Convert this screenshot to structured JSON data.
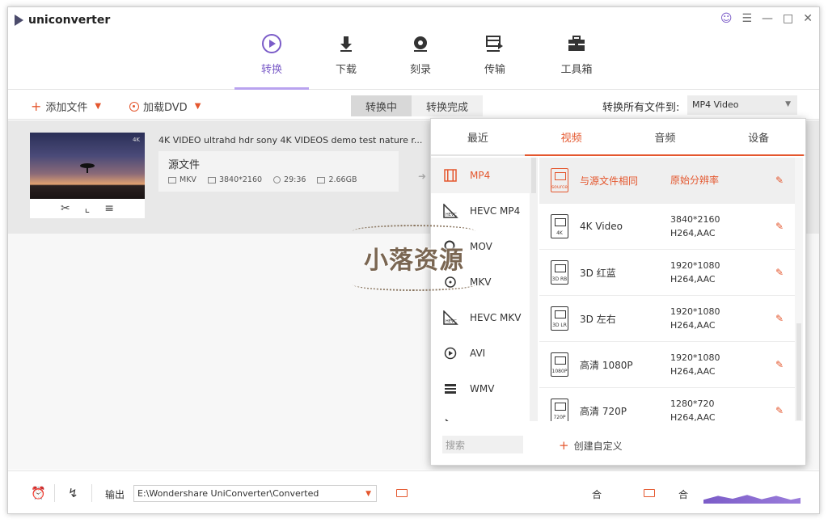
{
  "app": {
    "name": "uniconverter"
  },
  "nav": [
    {
      "key": "convert",
      "label": "转换",
      "active": true
    },
    {
      "key": "download",
      "label": "下载",
      "active": false
    },
    {
      "key": "burn",
      "label": "刻录",
      "active": false
    },
    {
      "key": "transfer",
      "label": "传输",
      "active": false
    },
    {
      "key": "tools",
      "label": "工具箱",
      "active": false
    }
  ],
  "toolbar": {
    "add_files": "添加文件",
    "load_dvd": "加载DVD",
    "seg_converting": "转换中",
    "seg_done": "转换完成",
    "convert_all_label": "转换所有文件到:",
    "target_format": "MP4 Video"
  },
  "file": {
    "title": "4K VIDEO ultrahd hdr sony 4K VIDEOS demo test nature r...",
    "thumb_badge": "4K",
    "source_label": "源文件",
    "format": "MKV",
    "resolution": "3840*2160",
    "duration": "29:36",
    "size": "2.66GB"
  },
  "panel": {
    "tabs": [
      "最近",
      "视频",
      "音频",
      "设备"
    ],
    "active_tab": 1,
    "formats": [
      {
        "label": "MP4",
        "icon": "film-icon",
        "active": true
      },
      {
        "label": "HEVC MP4",
        "icon": "hevc-icon",
        "active": false
      },
      {
        "label": "MOV",
        "icon": "quicktime-icon",
        "active": false
      },
      {
        "label": "MKV",
        "icon": "mkv-icon",
        "active": false
      },
      {
        "label": "HEVC MKV",
        "icon": "hevc-icon",
        "active": false
      },
      {
        "label": "AVI",
        "icon": "play-circle-icon",
        "active": false
      },
      {
        "label": "WMV",
        "icon": "wmv-icon",
        "active": false
      }
    ],
    "presets": [
      {
        "name": "与源文件相同",
        "res": "原始分辨率",
        "codec": "",
        "badge": "source",
        "active": true
      },
      {
        "name": "4K Video",
        "res": "3840*2160",
        "codec": "H264,AAC",
        "badge": "4K",
        "active": false
      },
      {
        "name": "3D 红蓝",
        "res": "1920*1080",
        "codec": "H264,AAC",
        "badge": "3D RB",
        "active": false
      },
      {
        "name": "3D 左右",
        "res": "1920*1080",
        "codec": "H264,AAC",
        "badge": "3D LR",
        "active": false
      },
      {
        "name": "高清 1080P",
        "res": "1920*1080",
        "codec": "H264,AAC",
        "badge": "1080P",
        "active": false
      },
      {
        "name": "高清 720P",
        "res": "1280*720",
        "codec": "H264,AAC",
        "badge": "720P",
        "active": false
      }
    ],
    "search_placeholder": "搜索",
    "create_custom": "创建自定义"
  },
  "bottom": {
    "output_label": "输出",
    "output_path": "E:\\Wondershare UniConverter\\Converted",
    "merge_label": "合",
    "merge2": "合"
  },
  "watermark": {
    "text": "小落资源"
  }
}
